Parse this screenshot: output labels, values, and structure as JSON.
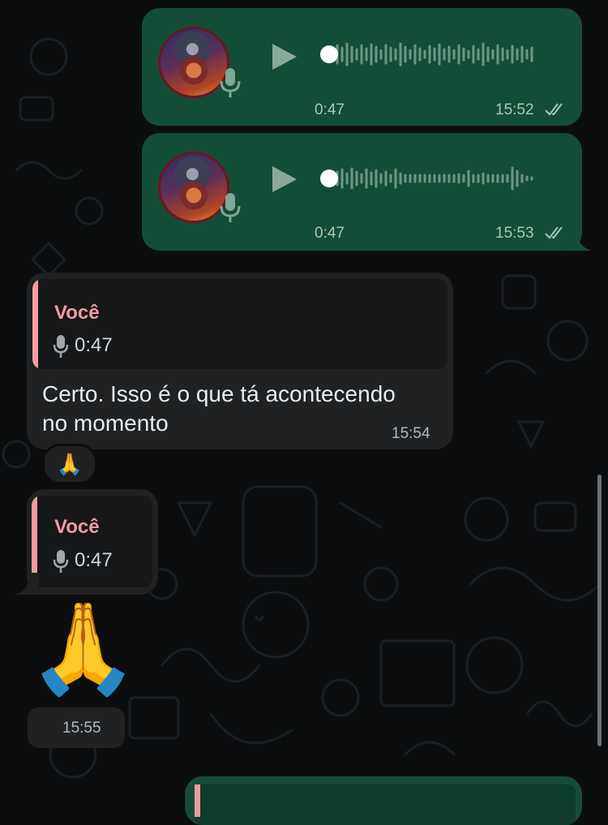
{
  "voice_messages": [
    {
      "duration": "0:47",
      "time": "15:52",
      "status": "read"
    },
    {
      "duration": "0:47",
      "time": "15:53",
      "status": "read"
    }
  ],
  "reply_message_1": {
    "quote_sender": "Você",
    "quote_duration": "0:47",
    "text_line1": "Certo. Isso é o que tá acontecendo",
    "text_line2": "no momento",
    "time": "15:54",
    "reaction": "🙏"
  },
  "reply_message_2": {
    "quote_sender": "Você",
    "quote_duration": "0:47",
    "emoji": "🙏",
    "time": "15:55"
  },
  "icons": [
    "play-icon",
    "microphone-icon",
    "double-check-icon",
    "avatar"
  ],
  "colors": {
    "outgoing_bubble": "#144d37",
    "incoming_bubble": "#1f2123",
    "quote_accent": "#f49aa2",
    "background": "#0b0d0e"
  }
}
